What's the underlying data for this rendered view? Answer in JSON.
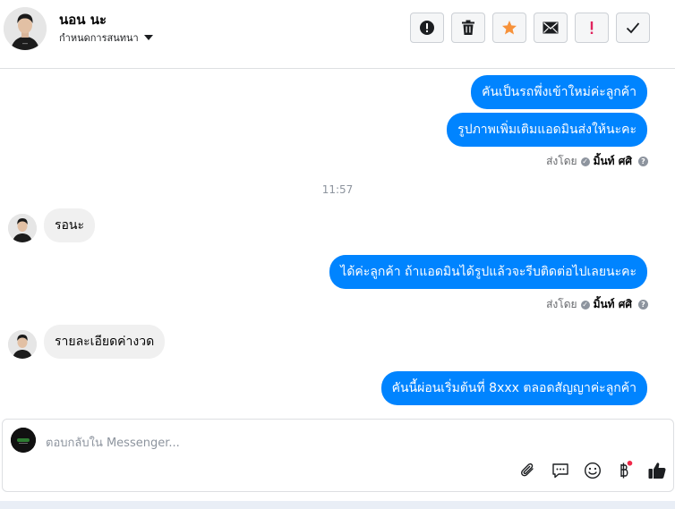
{
  "header": {
    "contact_name": "นอน นะ",
    "conversation_setting": "กำหนดการสนทนา",
    "toolbar": [
      {
        "name": "alert-icon"
      },
      {
        "name": "trash-icon"
      },
      {
        "name": "star-icon",
        "color": "#f7923a"
      },
      {
        "name": "mail-icon"
      },
      {
        "name": "exclamation-icon",
        "color": "#e0245e"
      },
      {
        "name": "check-icon"
      }
    ]
  },
  "thread": {
    "messages": [
      {
        "direction": "out",
        "text": "คันเป็นรถพึ่งเข้าใหม่ค่ะลูกค้า"
      },
      {
        "direction": "out",
        "text": "รูปภาพเพิ่มเติมแอดมินส่งให้นะคะ"
      },
      {
        "direction": "out",
        "text": "ได้ค่ะลูกค้า ถ้าแอดมินได้รูปแล้วจะรีบติดต่อไปเลยนะคะ"
      },
      {
        "direction": "out",
        "text": "คันนี้ผ่อนเริ่มต้นที่ 8xxx ตลอดสัญญาค่ะลูกค้า"
      },
      {
        "direction": "in",
        "text": "รอนะ"
      },
      {
        "direction": "in",
        "text": "รายละเอียดค่างวด"
      }
    ],
    "sent_by_label": "ส่งโดย",
    "sent_by_name": "มิ้นท์ ศศิ",
    "time_separator": "11:57"
  },
  "composer": {
    "placeholder": "ตอบกลับใน Messenger...",
    "icons": [
      "attachment-icon",
      "saved-reply-icon",
      "emoji-icon",
      "baht-icon",
      "like-icon"
    ]
  },
  "colors": {
    "accent": "#0084ff",
    "incoming": "#f0f0f0"
  }
}
